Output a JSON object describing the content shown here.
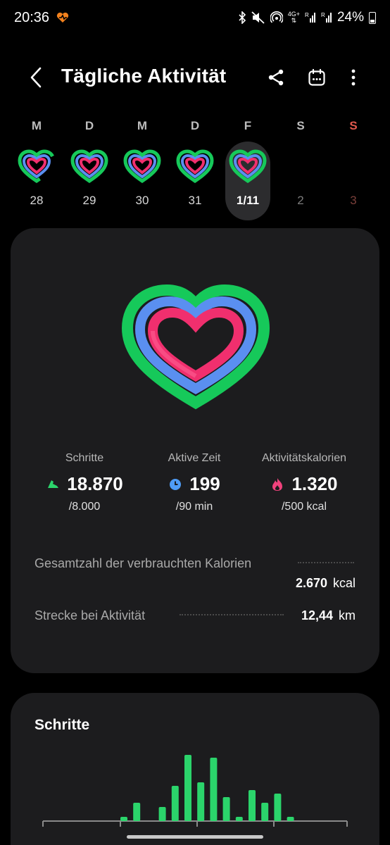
{
  "status_bar": {
    "time": "20:36",
    "network_label": "4G+",
    "battery_percent": "24%"
  },
  "header": {
    "title": "Tägliche Aktivität",
    "back_icon": "chevron-left-icon",
    "share_icon": "share-icon",
    "calendar_icon": "calendar-icon",
    "more_icon": "more-vertical-icon"
  },
  "week": {
    "days": [
      {
        "letter": "M",
        "date": "28",
        "has_ring": true,
        "selected": false,
        "partial": true
      },
      {
        "letter": "D",
        "date": "29",
        "has_ring": true,
        "selected": false,
        "partial": false
      },
      {
        "letter": "M",
        "date": "30",
        "has_ring": true,
        "selected": false,
        "partial": false
      },
      {
        "letter": "D",
        "date": "31",
        "has_ring": true,
        "selected": false,
        "partial": false
      },
      {
        "letter": "F",
        "date": "1/11",
        "has_ring": true,
        "selected": true,
        "partial": false
      },
      {
        "letter": "S",
        "date": "2",
        "has_ring": false,
        "selected": false,
        "partial": false
      },
      {
        "letter": "S",
        "date": "3",
        "has_ring": false,
        "selected": false,
        "partial": false
      }
    ]
  },
  "summary": {
    "stats": [
      {
        "label": "Schritte",
        "value": "18.870",
        "goal": "/8.000",
        "icon": "shoe-icon",
        "color": "#2bd46b"
      },
      {
        "label": "Aktive Zeit",
        "value": "199",
        "goal": "/90 min",
        "icon": "clock-icon",
        "color": "#4f9cf5"
      },
      {
        "label": "Aktivitätskalorien",
        "value": "1.320",
        "goal": "/500 kcal",
        "icon": "flame-icon",
        "color": "#f0427c"
      }
    ],
    "details": [
      {
        "label": "Gesamtzahl der verbrauchten Kalorien",
        "value": "2.670",
        "unit": "kcal"
      },
      {
        "label": "Strecke bei Aktivität",
        "value": "12,44",
        "unit": "km"
      }
    ],
    "ring_colors": {
      "steps": "#1ed760",
      "active_time": "#5a8ff0",
      "calories": "#f02f6e"
    }
  },
  "steps_section": {
    "title": "Schritte",
    "chart_data": {
      "type": "bar",
      "bar_color": "#2bd46b",
      "values": [
        0.06,
        0.26,
        0,
        0.2,
        0.5,
        0.94,
        0.55,
        0.9,
        0.34,
        0.06,
        0.44,
        0.26,
        0.39,
        0.06
      ],
      "ylim": [
        0,
        1
      ]
    }
  }
}
